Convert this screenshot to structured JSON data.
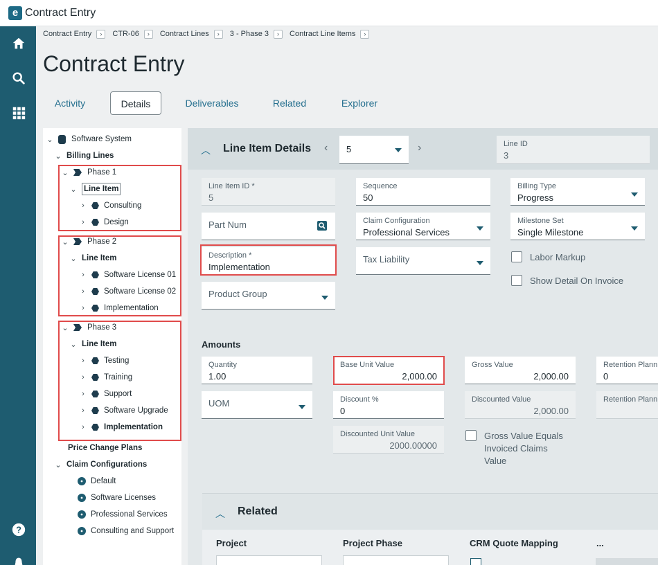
{
  "app": {
    "title": "Contract Entry",
    "logo": "e"
  },
  "nav": {
    "icons": [
      "home-icon",
      "search-icon",
      "apps-grid-icon",
      "help-icon"
    ]
  },
  "breadcrumb": [
    "Contract Entry",
    "CTR-06",
    "Contract Lines",
    "3 - Phase 3",
    "Contract Line Items"
  ],
  "page_title": "Contract Entry",
  "tabs": [
    "Activity",
    "Details",
    "Deliverables",
    "Related",
    "Explorer"
  ],
  "active_tab": "Details",
  "tree": {
    "root": "Software System",
    "billing_lines": "Billing Lines",
    "phase1": {
      "label": "Phase 1",
      "line_item": "Line Item",
      "items": [
        "Consulting",
        "Design"
      ]
    },
    "phase2": {
      "label": "Phase 2",
      "line_item": "Line Item",
      "items": [
        "Software License 01",
        "Software License 02",
        "Implementation"
      ]
    },
    "phase3": {
      "label": "Phase 3",
      "line_item": "Line Item",
      "items": [
        "Testing",
        "Training",
        "Support",
        "Software Upgrade",
        "Implementation"
      ]
    },
    "price_change_plans": "Price Change Plans",
    "claim_configurations": {
      "label": "Claim Configurations",
      "items": [
        "Default",
        "Software Licenses",
        "Professional Services",
        "Consulting and Support"
      ]
    }
  },
  "line_item": {
    "title": "Line Item Details",
    "selector_value": "5",
    "line_id": {
      "label": "Line ID",
      "value": "3"
    },
    "line_item_id": {
      "label": "Line Item ID *",
      "value": "5"
    },
    "sequence": {
      "label": "Sequence",
      "value": "50"
    },
    "billing_type": {
      "label": "Billing Type",
      "value": "Progress"
    },
    "part_num": {
      "label": "Part Num"
    },
    "claim_configuration": {
      "label": "Claim Configuration",
      "value": "Professional Services"
    },
    "milestone_set": {
      "label": "Milestone Set",
      "value": "Single Milestone"
    },
    "description": {
      "label": "Description *",
      "value": "Implementation"
    },
    "tax_liability": {
      "label": "Tax Liability"
    },
    "labor_markup": "Labor Markup",
    "show_detail_on_invoice": "Show Detail On Invoice",
    "product_group": {
      "label": "Product Group"
    }
  },
  "amounts": {
    "title": "Amounts",
    "quantity": {
      "label": "Quantity",
      "value": "1.00"
    },
    "base_unit_value": {
      "label": "Base Unit Value",
      "value": "2,000.00"
    },
    "gross_value": {
      "label": "Gross Value",
      "value": "2,000.00"
    },
    "retention_plan": {
      "label": "Retention Plann",
      "value": "0"
    },
    "uom": {
      "label": "UOM"
    },
    "discount_pct": {
      "label": "Discount %",
      "value": "0"
    },
    "discounted_value": {
      "label": "Discounted Value",
      "value": "2,000.00"
    },
    "retention_plan2": {
      "label": "Retention Plann"
    },
    "discounted_unit_value": {
      "label": "Discounted Unit Value",
      "value": "2000.00000"
    },
    "gross_equals_invoiced": [
      "Gross Value Equals",
      "Invoiced Claims",
      "Value"
    ]
  },
  "related": {
    "title": "Related",
    "columns": [
      "Project",
      "Project Phase",
      "CRM Quote Mapping",
      "..."
    ]
  },
  "colors": {
    "nav": "#1e5c70",
    "accent": "#26708f",
    "highlight": "#e04b4b"
  }
}
